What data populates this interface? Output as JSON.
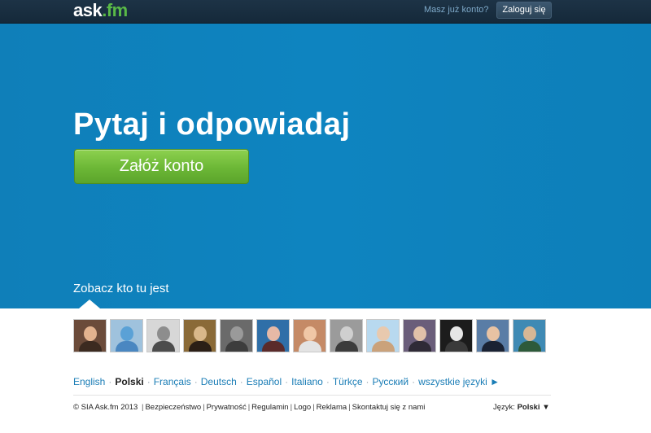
{
  "header": {
    "logo_main": "ask",
    "logo_suffix": ".fm",
    "have_account_text": "Masz już konto?",
    "login_label": "Zaloguj się"
  },
  "hero": {
    "headline": "Pytaj i odpowiadaj",
    "signup_label": "Załóż konto",
    "see_who_text": "Zobacz kto tu jest",
    "background_color": "#0e82be",
    "button_color": "#6cb736"
  },
  "avatars": [
    {
      "bg": "#6b4b3a",
      "head": "#e3b38f",
      "body": "#3b2a20"
    },
    {
      "bg": "#9fc2dd",
      "head": "#5aa1d6",
      "body": "#4a87c1"
    },
    {
      "bg": "#d7d7d7",
      "head": "#8d8d8d",
      "body": "#4d4d4d"
    },
    {
      "bg": "#8a6a37",
      "head": "#d9b88a",
      "body": "#2b1f16"
    },
    {
      "bg": "#6a6a6a",
      "head": "#9a9a9a",
      "body": "#3d3d3d"
    },
    {
      "bg": "#2f6fa8",
      "head": "#e6b9a6",
      "body": "#5a2b2b"
    },
    {
      "bg": "#c58a66",
      "head": "#f0c7a6",
      "body": "#e3e3e3"
    },
    {
      "bg": "#9b9b9b",
      "head": "#cfcfcf",
      "body": "#3c3c3c"
    },
    {
      "bg": "#b8d9ef",
      "head": "#e8c9ae",
      "body": "#caa27b"
    },
    {
      "bg": "#6a5d7a",
      "head": "#e1c1a9",
      "body": "#2f2a36"
    },
    {
      "bg": "#1c1c1c",
      "head": "#e6e6e6",
      "body": "#3a3a3a"
    },
    {
      "bg": "#5a7da6",
      "head": "#e8c2a3",
      "body": "#1a2233"
    },
    {
      "bg": "#3f8ab4",
      "head": "#d8b795",
      "body": "#2d5a3a"
    }
  ],
  "languages": [
    {
      "label": "English",
      "current": false
    },
    {
      "label": "Polski",
      "current": true
    },
    {
      "label": "Français",
      "current": false
    },
    {
      "label": "Deutsch",
      "current": false
    },
    {
      "label": "Español",
      "current": false
    },
    {
      "label": "Italiano",
      "current": false
    },
    {
      "label": "Türkçe",
      "current": false
    },
    {
      "label": "Русский",
      "current": false
    },
    {
      "label": "wszystkie języki ►",
      "current": false
    }
  ],
  "footer": {
    "copyright": "© SIA Ask.fm 2013",
    "links": [
      "Bezpieczeństwo",
      "Prywatność",
      "Regulamin",
      "Logo",
      "Reklama",
      "Skontaktuj się z nami"
    ],
    "language_label": "Język:",
    "language_value": "Polski",
    "language_arrow": "▼"
  }
}
